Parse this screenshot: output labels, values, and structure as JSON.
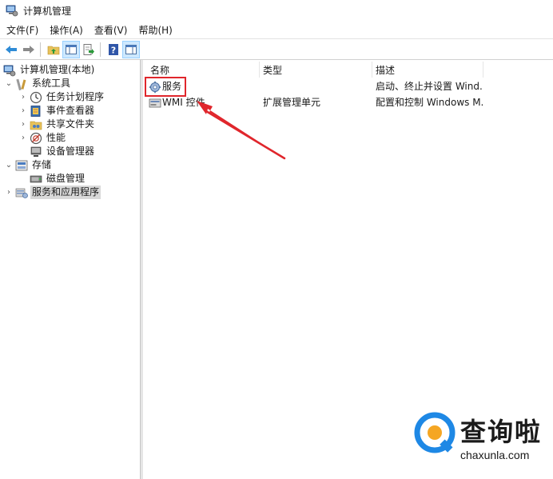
{
  "window": {
    "title": "计算机管理",
    "icon": "computer-management-icon"
  },
  "menu": [
    "文件(F)",
    "操作(A)",
    "查看(V)",
    "帮助(H)"
  ],
  "toolbar": {
    "buttons": [
      "back-icon",
      "forward-icon",
      "up-folder-icon",
      "show-hide-tree-icon",
      "export-list-icon",
      "help-icon",
      "show-hide-action-pane-icon"
    ]
  },
  "tree": {
    "root": "计算机管理(本地)",
    "system_tools": "系统工具",
    "task_scheduler": "任务计划程序",
    "event_viewer": "事件查看器",
    "shared_folders": "共享文件夹",
    "performance": "性能",
    "device_manager": "设备管理器",
    "storage": "存储",
    "disk_management": "磁盘管理",
    "services_apps": "服务和应用程序"
  },
  "list": {
    "headers": {
      "name": "名称",
      "type": "类型",
      "description": "描述"
    },
    "rows": [
      {
        "name": "服务",
        "type": "",
        "description": "启动、终止并设置 Wind...",
        "icon": "services-gear-icon"
      },
      {
        "name": "WMI 控件",
        "type": "扩展管理单元",
        "description": "配置和控制 Windows M...",
        "icon": "wmi-control-icon"
      }
    ]
  },
  "annotation": {
    "color": "#e0262c"
  },
  "watermark": {
    "brand": "查询啦",
    "url": "chaxunla.com",
    "accent": "#1e88e5",
    "accent2": "#f5a623"
  }
}
